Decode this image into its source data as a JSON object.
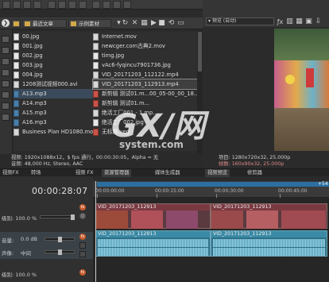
{
  "explorer": {
    "path_left": "最近文章",
    "path_mid": "示例素材",
    "files_col1": [
      "00.jpg",
      "001.jpg",
      "002.jpg",
      "003.jpg",
      "004.jpg",
      "1208测试视频000.avi",
      "A13.mp3",
      "A14.mp3",
      "A15.mp3",
      "A16.mp3",
      "Business Plan HD1080.mov"
    ],
    "files_col2": [
      "Internet.mov",
      "newcger.com古典2.mov",
      "timg.jpg",
      "vAc6-fyqincu7901736.jpg",
      "VID_20171203_112122.mp4",
      "VID_20171203_112913.mp4",
      "新剪辑 测试01.m...00_05-00_00_18...",
      "新剪辑 测试01.m...",
      "绝活工厂001 - 1.mp...",
      "绝活工厂002.jpg",
      "无标题.veg"
    ],
    "info_line1": "视频: 1920x1088x12，$ fps 通行，00:00:30:05，Alpha = 无",
    "info_line2": "音频: 48,000 Hz, Stereo, AAC",
    "colors": {
      "accent": "#2c6fa0",
      "video_clip": "#7a3940",
      "audio_clip": "#3a8aa6"
    }
  },
  "preview": {
    "info_line1": "项目: 1280x720x32, 25.000p",
    "info_line2": "帧数: 160x90x32, 25.000p"
  },
  "tabs": [
    "视频FX",
    "转场",
    "视频 FX",
    "资源管理器",
    "媒体生成器",
    "视频预览",
    "修剪器"
  ],
  "timeline": {
    "timecode": "00:00:28:07",
    "ruler": [
      "00:00:00:00",
      "00:00:15:00",
      "00:00:30:00",
      "00:00:45:00"
    ],
    "video_track": {
      "level_label": "级别:",
      "level_value": "100.0 %",
      "clips": [
        "VID_20171203_112913",
        "VID_20171203_112913"
      ]
    },
    "audio_track": {
      "vol_label": "音量:",
      "vol_value": "0.0 dB",
      "pan_label": "声像:",
      "pan_value": "中间",
      "clips": [
        "VID_20171203_112913",
        "VID_20171203_112913"
      ]
    },
    "bottom_level": "级别: 100.0 %",
    "loop_end": "+54"
  },
  "watermark": {
    "main": "GX/网",
    "sub": "system.com"
  }
}
